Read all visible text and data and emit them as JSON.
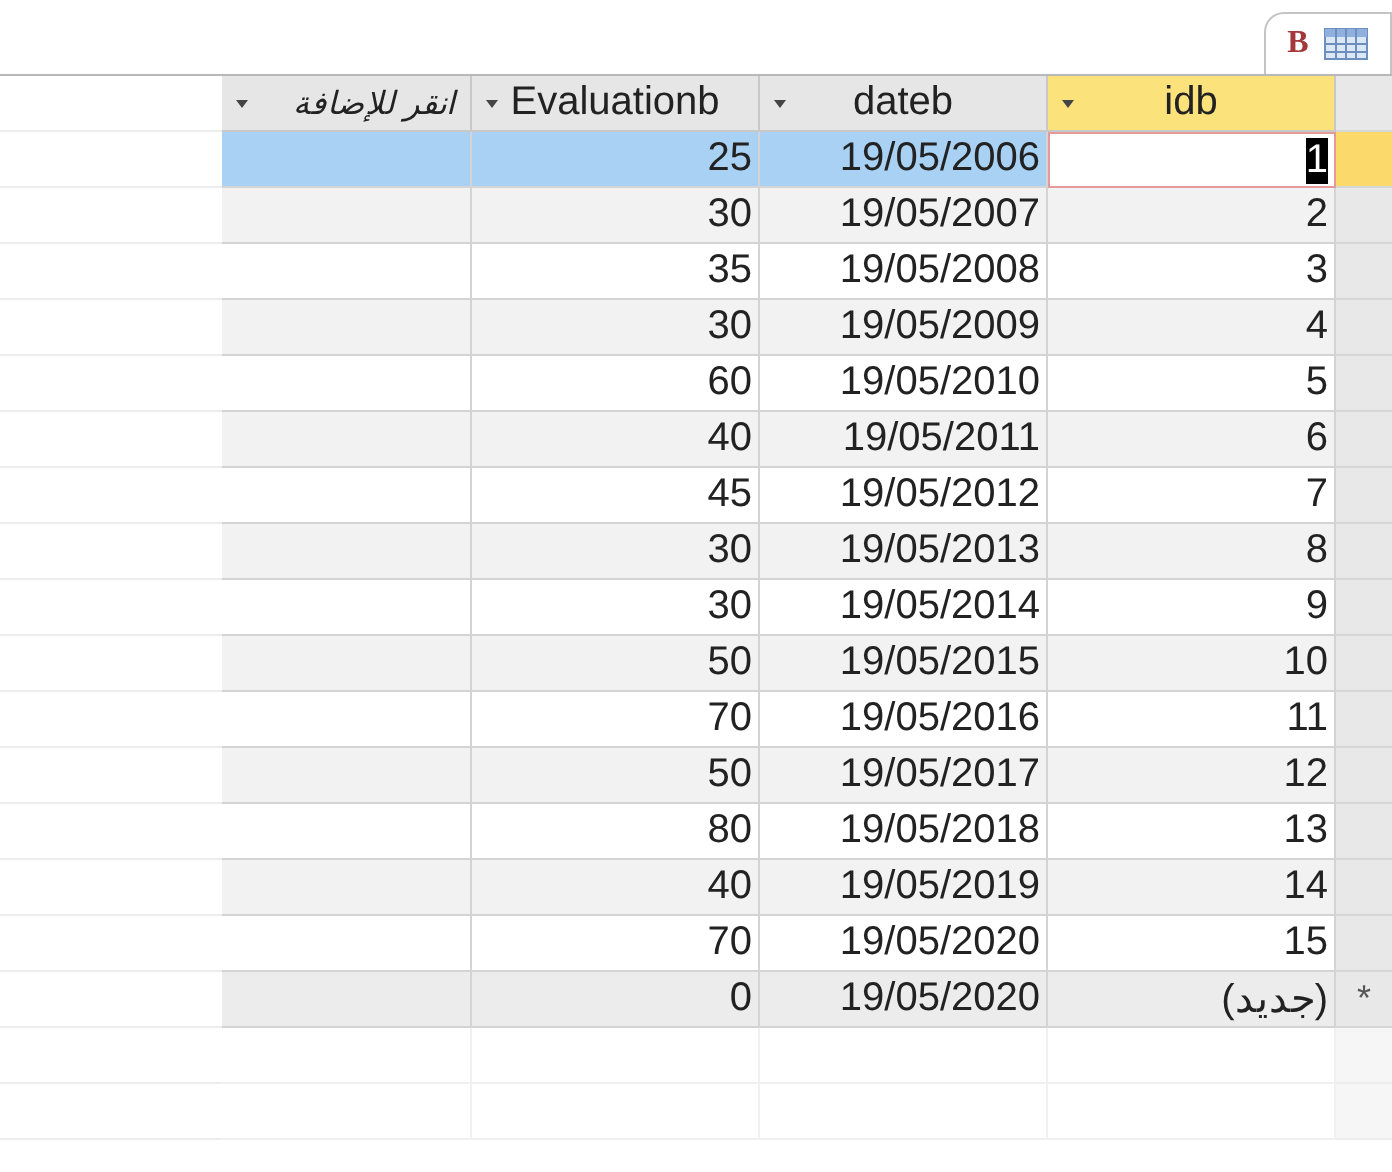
{
  "tab": {
    "letter": "B"
  },
  "columns": [
    {
      "label": "انقر للإضافة",
      "kind": "add"
    },
    {
      "label": "Evaluationb"
    },
    {
      "label": "dateb"
    },
    {
      "label": "idb",
      "kind": "key"
    }
  ],
  "rows": [
    {
      "kind": "record",
      "selected": true,
      "cells": [
        "25",
        "19/05/2006",
        "1"
      ]
    },
    {
      "kind": "record",
      "selected": false,
      "cells": [
        "30",
        "19/05/2007",
        "2"
      ]
    },
    {
      "kind": "record",
      "selected": false,
      "cells": [
        "35",
        "19/05/2008",
        "3"
      ]
    },
    {
      "kind": "record",
      "selected": false,
      "cells": [
        "30",
        "19/05/2009",
        "4"
      ]
    },
    {
      "kind": "record",
      "selected": false,
      "cells": [
        "60",
        "19/05/2010",
        "5"
      ]
    },
    {
      "kind": "record",
      "selected": false,
      "cells": [
        "40",
        "19/05/2011",
        "6"
      ]
    },
    {
      "kind": "record",
      "selected": false,
      "cells": [
        "45",
        "19/05/2012",
        "7"
      ]
    },
    {
      "kind": "record",
      "selected": false,
      "cells": [
        "30",
        "19/05/2013",
        "8"
      ]
    },
    {
      "kind": "record",
      "selected": false,
      "cells": [
        "30",
        "19/05/2014",
        "9"
      ]
    },
    {
      "kind": "record",
      "selected": false,
      "cells": [
        "50",
        "19/05/2015",
        "10"
      ]
    },
    {
      "kind": "record",
      "selected": false,
      "cells": [
        "70",
        "19/05/2016",
        "11"
      ]
    },
    {
      "kind": "record",
      "selected": false,
      "cells": [
        "50",
        "19/05/2017",
        "12"
      ]
    },
    {
      "kind": "record",
      "selected": false,
      "cells": [
        "80",
        "19/05/2018",
        "13"
      ]
    },
    {
      "kind": "record",
      "selected": false,
      "cells": [
        "40",
        "19/05/2019",
        "14"
      ]
    },
    {
      "kind": "record",
      "selected": false,
      "cells": [
        "70",
        "19/05/2020",
        "15"
      ]
    },
    {
      "kind": "new",
      "selected": false,
      "marker": "*",
      "cells": [
        "0",
        "19/05/2020",
        "(جديد)"
      ]
    }
  ]
}
